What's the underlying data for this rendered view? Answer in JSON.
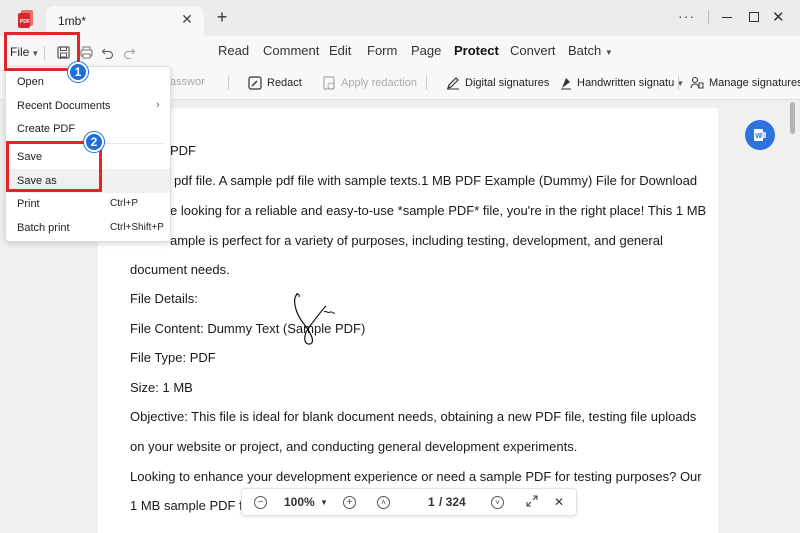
{
  "window": {
    "tab_title": "1mb*",
    "close_glyph": "✕",
    "add_glyph": "+",
    "more_glyph": "···"
  },
  "toolbar": {
    "file_label": "File",
    "tabs": [
      "Read",
      "Comment",
      "Edit",
      "Form",
      "Page",
      "Protect",
      "Convert",
      "Batch"
    ],
    "active_tab": "Protect"
  },
  "protect_toolbar": {
    "password_partial": "asswor",
    "redact": "Redact",
    "apply_redaction": "Apply redaction",
    "digital_signatures": "Digital signatures",
    "handwritten": "Handwritten signatu",
    "manage_signatures": "Manage signatures"
  },
  "file_menu": {
    "items": [
      {
        "label": "Open",
        "shortcut": ""
      },
      {
        "label": "Recent Documents",
        "shortcut": "",
        "submenu_arrow": "›"
      },
      {
        "label": "Create PDF",
        "shortcut": ""
      },
      {
        "label": "Save",
        "shortcut": ""
      },
      {
        "label": "Save as",
        "shortcut": ""
      },
      {
        "label": "Print",
        "shortcut": "Ctrl+P"
      },
      {
        "label": "Batch print",
        "shortcut": "Ctrl+Shift+P"
      }
    ]
  },
  "annotations": {
    "badge1": "1",
    "badge2": "2",
    "color": "#e0262b",
    "badge_color": "#1f6fd6"
  },
  "document": {
    "lines": [
      "PDF",
      "pdf file. A sample pdf file with sample texts.1 MB PDF Example (Dummy) File for Download",
      "e looking for a reliable and easy-to-use *sample PDF* file, you're in the right place! This 1 MB",
      "ample is perfect for a variety of purposes, including testing, development, and general",
      "document needs.",
      "File Details:",
      "File Content: Dummy Text (Sample PDF)",
      "File Type: PDF",
      "Size: 1 MB",
      "Objective: This file is ideal for blank document needs, obtaining a new PDF file, testing file uploads",
      "on your website or project, and conducting general development experiments.",
      "Looking to enhance your development experience or need a sample PDF for testing purposes? Our",
      "1 MB sample PDF fi"
    ]
  },
  "zoom": {
    "level": "100%",
    "page_current": "1",
    "page_total": "/ 324"
  }
}
